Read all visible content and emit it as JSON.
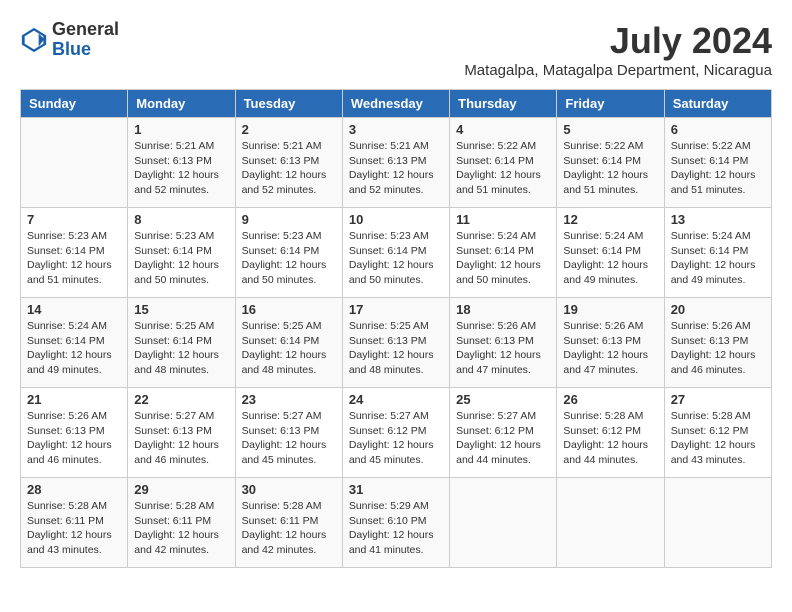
{
  "logo": {
    "general": "General",
    "blue": "Blue"
  },
  "title": "July 2024",
  "location": "Matagalpa, Matagalpa Department, Nicaragua",
  "days_of_week": [
    "Sunday",
    "Monday",
    "Tuesday",
    "Wednesday",
    "Thursday",
    "Friday",
    "Saturday"
  ],
  "weeks": [
    [
      {
        "day": "",
        "info": ""
      },
      {
        "day": "1",
        "info": "Sunrise: 5:21 AM\nSunset: 6:13 PM\nDaylight: 12 hours\nand 52 minutes."
      },
      {
        "day": "2",
        "info": "Sunrise: 5:21 AM\nSunset: 6:13 PM\nDaylight: 12 hours\nand 52 minutes."
      },
      {
        "day": "3",
        "info": "Sunrise: 5:21 AM\nSunset: 6:13 PM\nDaylight: 12 hours\nand 52 minutes."
      },
      {
        "day": "4",
        "info": "Sunrise: 5:22 AM\nSunset: 6:14 PM\nDaylight: 12 hours\nand 51 minutes."
      },
      {
        "day": "5",
        "info": "Sunrise: 5:22 AM\nSunset: 6:14 PM\nDaylight: 12 hours\nand 51 minutes."
      },
      {
        "day": "6",
        "info": "Sunrise: 5:22 AM\nSunset: 6:14 PM\nDaylight: 12 hours\nand 51 minutes."
      }
    ],
    [
      {
        "day": "7",
        "info": "Sunrise: 5:23 AM\nSunset: 6:14 PM\nDaylight: 12 hours\nand 51 minutes."
      },
      {
        "day": "8",
        "info": "Sunrise: 5:23 AM\nSunset: 6:14 PM\nDaylight: 12 hours\nand 50 minutes."
      },
      {
        "day": "9",
        "info": "Sunrise: 5:23 AM\nSunset: 6:14 PM\nDaylight: 12 hours\nand 50 minutes."
      },
      {
        "day": "10",
        "info": "Sunrise: 5:23 AM\nSunset: 6:14 PM\nDaylight: 12 hours\nand 50 minutes."
      },
      {
        "day": "11",
        "info": "Sunrise: 5:24 AM\nSunset: 6:14 PM\nDaylight: 12 hours\nand 50 minutes."
      },
      {
        "day": "12",
        "info": "Sunrise: 5:24 AM\nSunset: 6:14 PM\nDaylight: 12 hours\nand 49 minutes."
      },
      {
        "day": "13",
        "info": "Sunrise: 5:24 AM\nSunset: 6:14 PM\nDaylight: 12 hours\nand 49 minutes."
      }
    ],
    [
      {
        "day": "14",
        "info": "Sunrise: 5:24 AM\nSunset: 6:14 PM\nDaylight: 12 hours\nand 49 minutes."
      },
      {
        "day": "15",
        "info": "Sunrise: 5:25 AM\nSunset: 6:14 PM\nDaylight: 12 hours\nand 48 minutes."
      },
      {
        "day": "16",
        "info": "Sunrise: 5:25 AM\nSunset: 6:14 PM\nDaylight: 12 hours\nand 48 minutes."
      },
      {
        "day": "17",
        "info": "Sunrise: 5:25 AM\nSunset: 6:13 PM\nDaylight: 12 hours\nand 48 minutes."
      },
      {
        "day": "18",
        "info": "Sunrise: 5:26 AM\nSunset: 6:13 PM\nDaylight: 12 hours\nand 47 minutes."
      },
      {
        "day": "19",
        "info": "Sunrise: 5:26 AM\nSunset: 6:13 PM\nDaylight: 12 hours\nand 47 minutes."
      },
      {
        "day": "20",
        "info": "Sunrise: 5:26 AM\nSunset: 6:13 PM\nDaylight: 12 hours\nand 46 minutes."
      }
    ],
    [
      {
        "day": "21",
        "info": "Sunrise: 5:26 AM\nSunset: 6:13 PM\nDaylight: 12 hours\nand 46 minutes."
      },
      {
        "day": "22",
        "info": "Sunrise: 5:27 AM\nSunset: 6:13 PM\nDaylight: 12 hours\nand 46 minutes."
      },
      {
        "day": "23",
        "info": "Sunrise: 5:27 AM\nSunset: 6:13 PM\nDaylight: 12 hours\nand 45 minutes."
      },
      {
        "day": "24",
        "info": "Sunrise: 5:27 AM\nSunset: 6:12 PM\nDaylight: 12 hours\nand 45 minutes."
      },
      {
        "day": "25",
        "info": "Sunrise: 5:27 AM\nSunset: 6:12 PM\nDaylight: 12 hours\nand 44 minutes."
      },
      {
        "day": "26",
        "info": "Sunrise: 5:28 AM\nSunset: 6:12 PM\nDaylight: 12 hours\nand 44 minutes."
      },
      {
        "day": "27",
        "info": "Sunrise: 5:28 AM\nSunset: 6:12 PM\nDaylight: 12 hours\nand 43 minutes."
      }
    ],
    [
      {
        "day": "28",
        "info": "Sunrise: 5:28 AM\nSunset: 6:11 PM\nDaylight: 12 hours\nand 43 minutes."
      },
      {
        "day": "29",
        "info": "Sunrise: 5:28 AM\nSunset: 6:11 PM\nDaylight: 12 hours\nand 42 minutes."
      },
      {
        "day": "30",
        "info": "Sunrise: 5:28 AM\nSunset: 6:11 PM\nDaylight: 12 hours\nand 42 minutes."
      },
      {
        "day": "31",
        "info": "Sunrise: 5:29 AM\nSunset: 6:10 PM\nDaylight: 12 hours\nand 41 minutes."
      },
      {
        "day": "",
        "info": ""
      },
      {
        "day": "",
        "info": ""
      },
      {
        "day": "",
        "info": ""
      }
    ]
  ]
}
